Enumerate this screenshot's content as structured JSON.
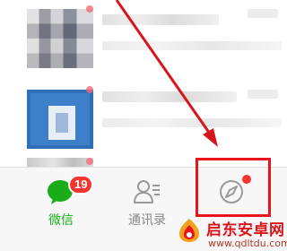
{
  "tabbar": {
    "tabs": [
      {
        "label": "微信",
        "badge": "19",
        "icon": "chat-bubble-icon",
        "active": true
      },
      {
        "label": "通讯录",
        "icon": "contacts-icon",
        "active": false
      },
      {
        "label": "",
        "icon": "compass-icon",
        "active": false,
        "dot": true
      }
    ]
  },
  "annotation": {
    "box_color": "#e8141b",
    "arrow_color": "#d8151b",
    "target": "discover-tab"
  },
  "watermark": {
    "title": "启东安卓网",
    "url": "www.qdltdu.com"
  },
  "colors": {
    "accent": "#1aad19",
    "badge": "#f43530",
    "inactive": "#888888"
  }
}
